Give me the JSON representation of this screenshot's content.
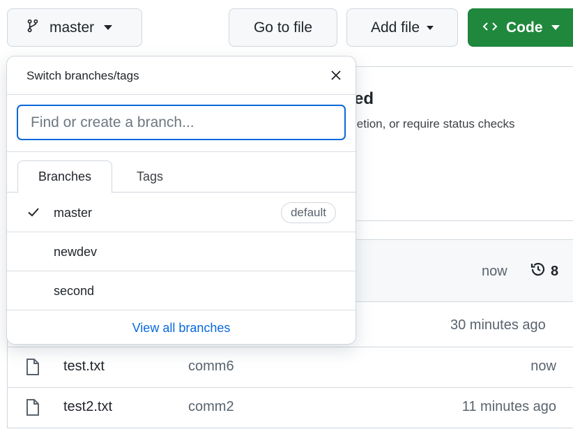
{
  "toolbar": {
    "branch_label": "master",
    "goto_label": "Go to file",
    "addfile_label": "Add file",
    "code_label": "Code"
  },
  "background": {
    "heading_fragment": "ed",
    "subtext_fragment": "letion, or require status checks",
    "commit_time": "now",
    "commit_count": "8",
    "row3_time": "30 minutes ago"
  },
  "files": [
    {
      "name": "test.txt",
      "message": "comm6",
      "time": "now"
    },
    {
      "name": "test2.txt",
      "message": "comm2",
      "time": "11 minutes ago"
    }
  ],
  "dropdown": {
    "title": "Switch branches/tags",
    "search_placeholder": "Find or create a branch...",
    "tabs": [
      {
        "label": "Branches",
        "active": true
      },
      {
        "label": "Tags",
        "active": false
      }
    ],
    "branches": [
      {
        "name": "master",
        "selected": true,
        "badge": "default"
      },
      {
        "name": "newdev",
        "selected": false,
        "badge": ""
      },
      {
        "name": "second",
        "selected": false,
        "badge": ""
      }
    ],
    "footer_link": "View all branches"
  },
  "colors": {
    "accent_blue": "#0969da",
    "code_green": "#1f883d",
    "border": "#d0d7de"
  },
  "icons": [
    "git-branch-icon",
    "caret-down-icon",
    "code-icon",
    "close-icon",
    "check-icon",
    "history-icon",
    "file-icon"
  ]
}
